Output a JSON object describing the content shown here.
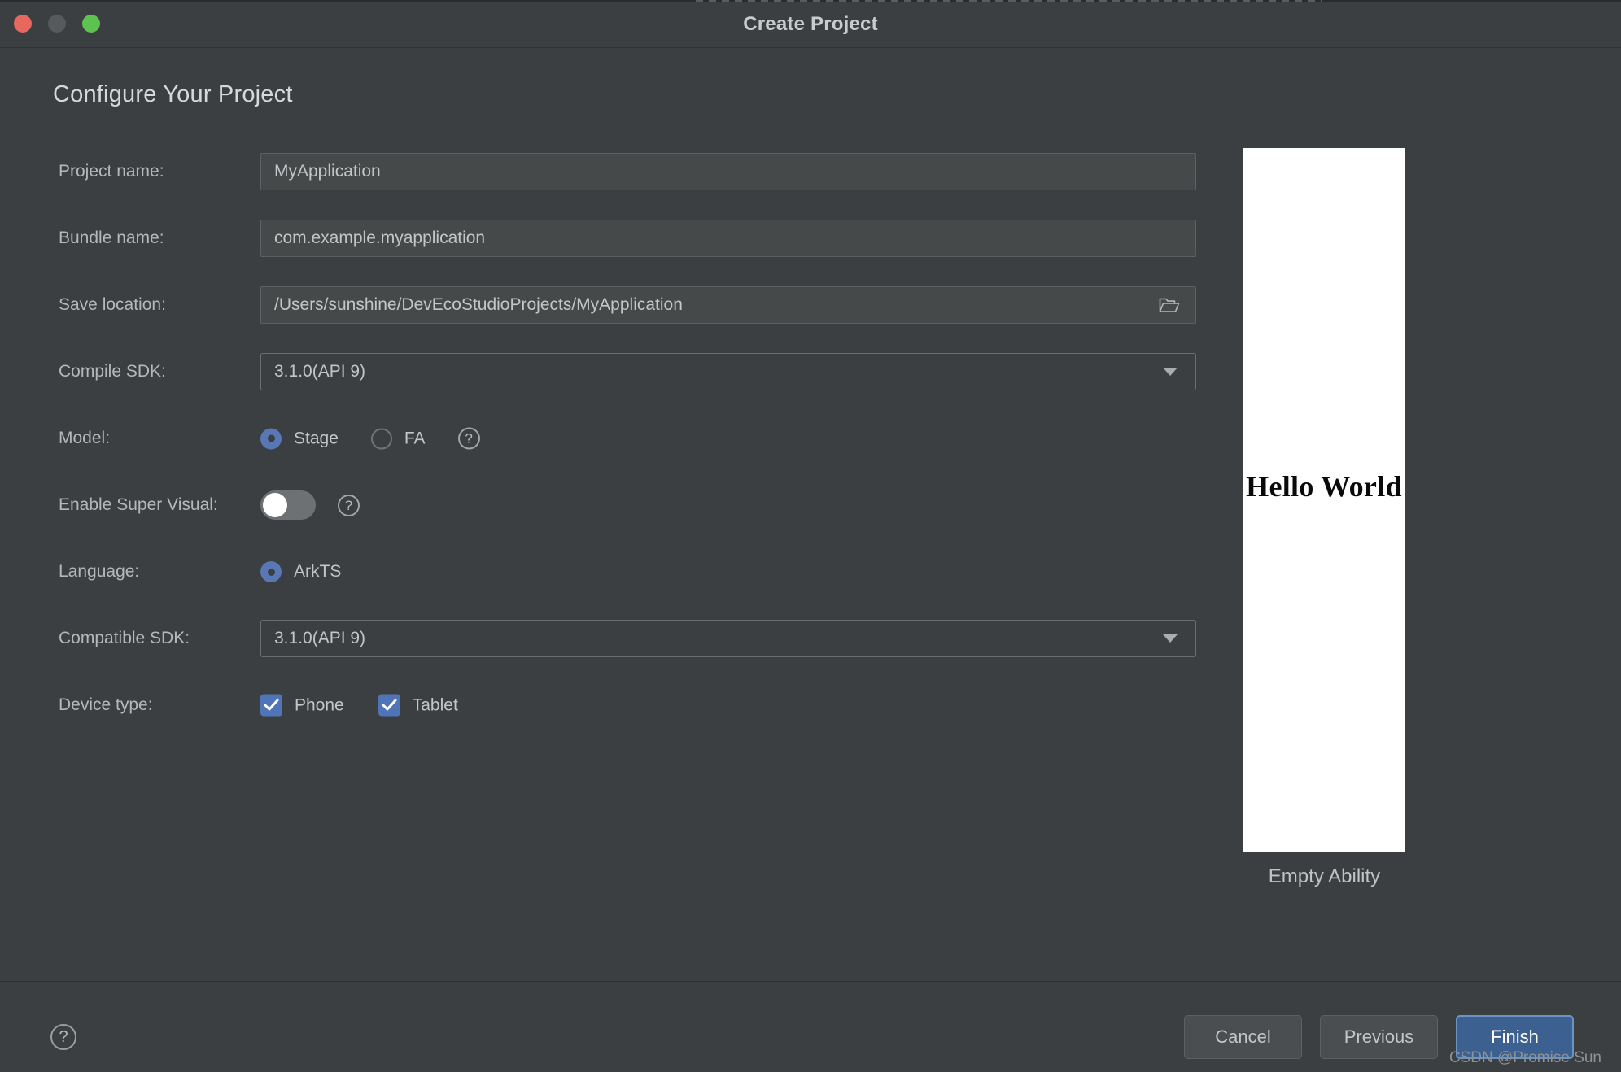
{
  "window": {
    "title": "Create Project",
    "traffic_lights": [
      "close-red",
      "minimize-gray",
      "zoom-green"
    ]
  },
  "page": {
    "heading": "Configure Your Project"
  },
  "form": {
    "project_name": {
      "label": "Project name:",
      "value": "MyApplication"
    },
    "bundle_name": {
      "label": "Bundle name:",
      "value": "com.example.myapplication"
    },
    "save_location": {
      "label": "Save location:",
      "value": "/Users/sunshine/DevEcoStudioProjects/MyApplication",
      "browse_icon": "folder-open-icon"
    },
    "compile_sdk": {
      "label": "Compile SDK:",
      "value": "3.1.0(API 9)"
    },
    "model": {
      "label": "Model:",
      "options": [
        {
          "label": "Stage",
          "selected": true
        },
        {
          "label": "FA",
          "selected": false
        }
      ],
      "help": "?"
    },
    "enable_super_visual": {
      "label": "Enable Super Visual:",
      "state": "off",
      "help": "?"
    },
    "language": {
      "label": "Language:",
      "options": [
        {
          "label": "ArkTS",
          "selected": true
        }
      ]
    },
    "compatible_sdk": {
      "label": "Compatible SDK:",
      "value": "3.1.0(API 9)"
    },
    "device_type": {
      "label": "Device type:",
      "options": [
        {
          "label": "Phone",
          "checked": true
        },
        {
          "label": "Tablet",
          "checked": true
        }
      ]
    }
  },
  "preview": {
    "screen_text": "Hello World",
    "caption": "Empty Ability"
  },
  "footer": {
    "help": "?",
    "cancel_label": "Cancel",
    "previous_label": "Previous",
    "finish_label": "Finish"
  },
  "watermark": "CSDN @Promise Sun",
  "colors": {
    "dialog_bg": "#3c3f41",
    "field_bg": "#45494a",
    "accent_blue": "#5977b5",
    "checkbox_blue": "#4f74b8",
    "primary_button": "#3c6090",
    "primary_button_ring": "#6b93c4",
    "text": "#c3c6c8",
    "label_text": "#b4b8ba"
  }
}
